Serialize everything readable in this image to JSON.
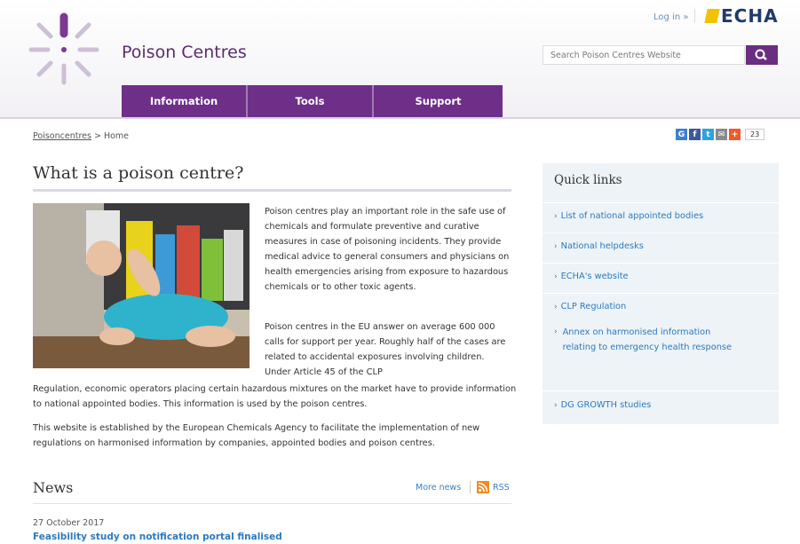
{
  "header": {
    "site_title": "Poison Centres",
    "login": "Log in »",
    "brand": "ECHA",
    "search_placeholder": "Search Poison Centres Website"
  },
  "nav": {
    "items": [
      {
        "label": "Information"
      },
      {
        "label": "Tools"
      },
      {
        "label": "Support"
      }
    ]
  },
  "breadcrumb": {
    "root": "Poisoncentres",
    "separator": ">",
    "current": "Home"
  },
  "social": {
    "icons": [
      "google-plus-icon",
      "facebook-icon",
      "twitter-icon",
      "email-icon",
      "share-icon"
    ],
    "count": "23"
  },
  "main": {
    "title": "What is a poison centre?",
    "p1": "Poison centres play an important role in the safe use of chemicals and formulate preventive and curative measures in case of poisoning incidents. They provide medical advice to general consumers and physicians on health emergencies arising from exposure to hazardous chemicals or to other toxic agents.",
    "p2": "Poison centres in the EU answer on average 600 000 calls for support per year. Roughly half of the cases are related to accidental exposures involving children. Under Article 45 of the CLP",
    "p2b": "Regulation, economic operators placing certain hazardous mixtures on the market have to provide information to national appointed bodies. This information is used by the poison centres.",
    "p3": "This website is established by the European Chemicals Agency to facilitate the implementation of new regulations on harmonised information by companies, appointed bodies and poison centres."
  },
  "news": {
    "title": "News",
    "more_news": "More news",
    "rss": "RSS",
    "items": [
      {
        "date": "27 October 2017",
        "title": "Feasibility study on notification portal finalised"
      }
    ]
  },
  "quick_links": {
    "title": "Quick links",
    "items": [
      {
        "label": "List of national appointed bodies"
      },
      {
        "label": "National helpdesks"
      },
      {
        "label": "ECHA's website"
      },
      {
        "label": "CLP Regulation"
      },
      {
        "label": "DG GROWTH studies"
      }
    ],
    "sub_item": "Annex on harmonised information relating to emergency health response"
  },
  "colors": {
    "brand_purple": "#6e2f88",
    "link_blue": "#2a7ac0",
    "quick_links_bg": "#eef3f7"
  }
}
